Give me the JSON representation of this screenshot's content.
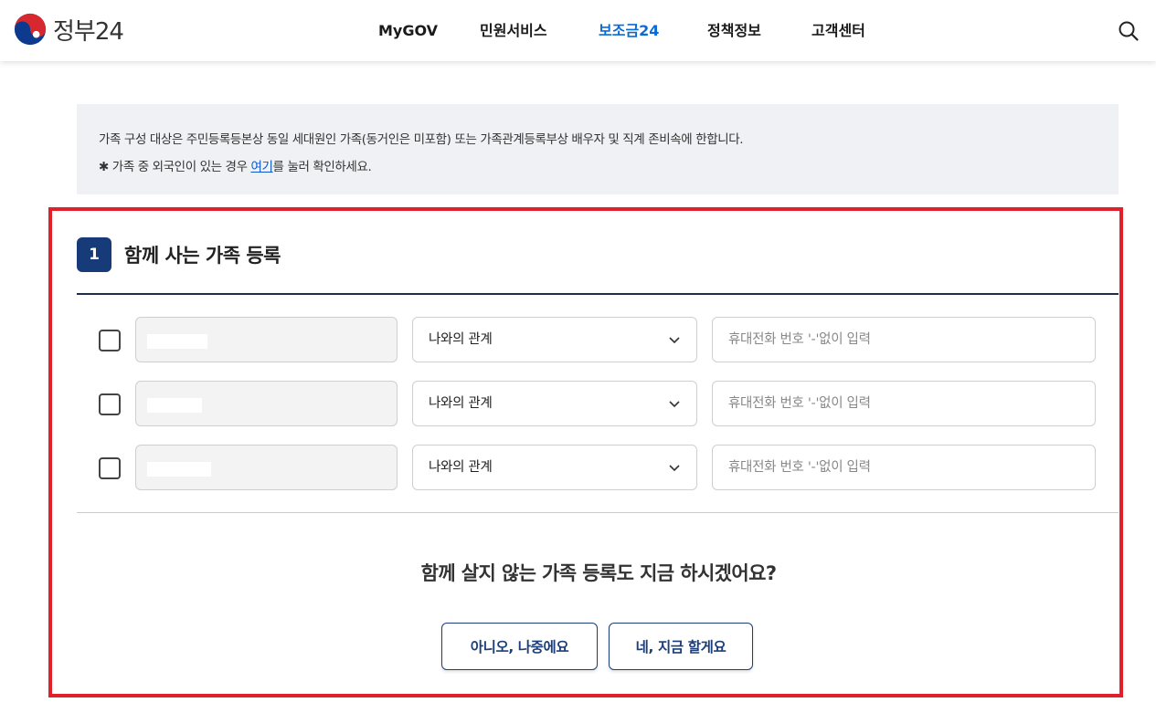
{
  "header": {
    "logo_text": "정부24",
    "nav": [
      "MyGOV",
      "민원서비스",
      "보조금24",
      "정책정보",
      "고객센터"
    ],
    "active_nav": "보조금24",
    "search_icon": "search-icon"
  },
  "notice": {
    "line1": "가족 구성 대상은 주민등록등본상 동일 세대원인 가족(동거인은 미포함) 또는 가족관계등록부상 배우자 및 직계 존비속에 한합니다.",
    "line2_prefix": "✱ 가족 중 외국인이 있는 경우 ",
    "line2_link": "여기",
    "line2_suffix": "를 눌러 확인하세요."
  },
  "section": {
    "step": "1",
    "title": "함께 사는 가족 등록"
  },
  "family_rows": [
    {
      "checked": false,
      "relation_label": "나와의 관계",
      "phone_placeholder": "휴대전화 번호 '-'없이 입력",
      "phone_value": ""
    },
    {
      "checked": false,
      "relation_label": "나와의 관계",
      "phone_placeholder": "휴대전화 번호 '-'없이 입력",
      "phone_value": ""
    },
    {
      "checked": false,
      "relation_label": "나와의 관계",
      "phone_placeholder": "휴대전화 번호 '-'없이 입력",
      "phone_value": ""
    }
  ],
  "question": "함께 살지 않는 가족 등록도 지금 하시겠어요?",
  "buttons": {
    "no": "아니오, 나중에요",
    "yes": "네, 지금 할게요"
  },
  "colors": {
    "accent": "#0b6bd6",
    "navy": "#173a78",
    "highlight": "#e0202b",
    "notice_bg": "#eff1f5"
  }
}
